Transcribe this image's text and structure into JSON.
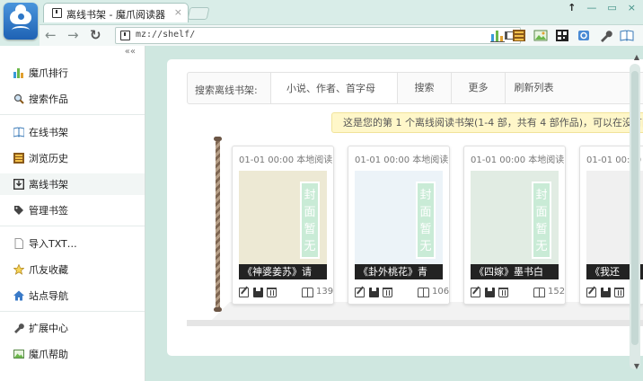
{
  "browser": {
    "tab_title": "离线书架 - 魔爪阅读器",
    "tab_close": "×",
    "address": "mz://shelf/",
    "nav": {
      "back": "←",
      "forward": "→",
      "refresh": "↻"
    },
    "window_controls": {
      "pin": "↑",
      "minimize": "—",
      "restore": "▭",
      "close": "×"
    }
  },
  "sidebar": {
    "collapse": "««",
    "items": [
      {
        "label": "魔爪排行",
        "icon": "bar-chart-icon"
      },
      {
        "label": "搜索作品",
        "icon": "magnifier-icon"
      },
      {
        "label": "在线书架",
        "icon": "book-icon"
      },
      {
        "label": "浏览历史",
        "icon": "history-icon"
      },
      {
        "label": "离线书架",
        "icon": "download-icon"
      },
      {
        "label": "管理书签",
        "icon": "tag-icon"
      },
      {
        "label": "导入TXT…",
        "icon": "file-icon"
      },
      {
        "label": "爪友收藏",
        "icon": "star-icon"
      },
      {
        "label": "站点导航",
        "icon": "home-icon"
      },
      {
        "label": "扩展中心",
        "icon": "wrench-icon"
      },
      {
        "label": "魔爪帮助",
        "icon": "help-image-icon"
      }
    ]
  },
  "search": {
    "label": "搜索离线书架:",
    "placeholder": "小说、作者、首字母",
    "search_button": "搜索",
    "more_button": "更多",
    "refresh_button": "刷新列表"
  },
  "notice": "这是您的第 1 个离线阅读书架(1-4 部，共有 4 部作品)，可以在没有网",
  "books": [
    {
      "date": "01-01 00:00 本地阅读",
      "title": "《神婆姜苏》请",
      "cover_text": "封面暂无",
      "reads": "139"
    },
    {
      "date": "01-01 00:00 本地阅读",
      "title": "《卦外桃花》青",
      "cover_text": "封面暂无",
      "reads": "106"
    },
    {
      "date": "01-01 00:00 本地阅读",
      "title": "《四嫁》墨书白",
      "cover_text": "封面暂无",
      "reads": "152"
    },
    {
      "date": "01-01 00:00 本地阅读",
      "title": "《我还",
      "cover_text": "",
      "reads": ""
    }
  ],
  "colors": {
    "accent": "#2d77c7",
    "cover_backgrounds": [
      "#ede9d4",
      "#ecf3f8",
      "#e1ece3",
      "#f0f0f0"
    ]
  }
}
